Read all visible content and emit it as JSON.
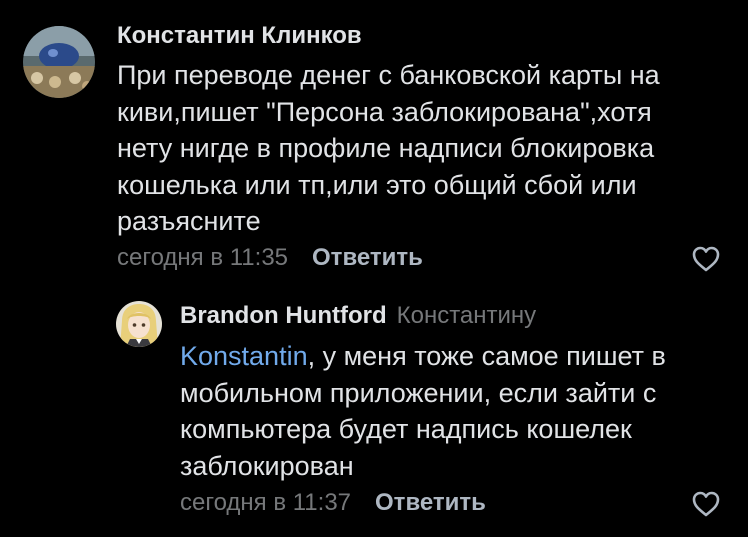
{
  "comments": [
    {
      "author": "Константин Клинков",
      "text_lines": [
        "При переводе денег с банковской карты на",
        "киви,пишет \"Персона заблокирована\",хотя",
        "нету нигде в профиле надписи блокировка",
        "кошелька или тп,или это общий сбой или",
        "разъясните"
      ],
      "timestamp": "сегодня в 11:35",
      "reply_label": "Ответить",
      "avatar_icon": "user-avatar-icon",
      "like_icon": "heart-outline-icon"
    },
    {
      "author": "Brandon Huntford",
      "reply_to": "Константину",
      "mention": "Konstantin",
      "text_lines": [
        ", у меня тоже самое пишет в",
        "мобильном приложении, если зайти с",
        "компьютера будет надпись кошелек",
        "заблокирован"
      ],
      "timestamp": "сегодня в 11:37",
      "reply_label": "Ответить",
      "avatar_icon": "user-avatar-icon",
      "like_icon": "heart-outline-icon"
    }
  ],
  "colors": {
    "background": "#000000",
    "text": "#e1e3e6",
    "secondary": "#76787a",
    "mention": "#71aaeb",
    "reply_button": "#aeb7c2"
  }
}
